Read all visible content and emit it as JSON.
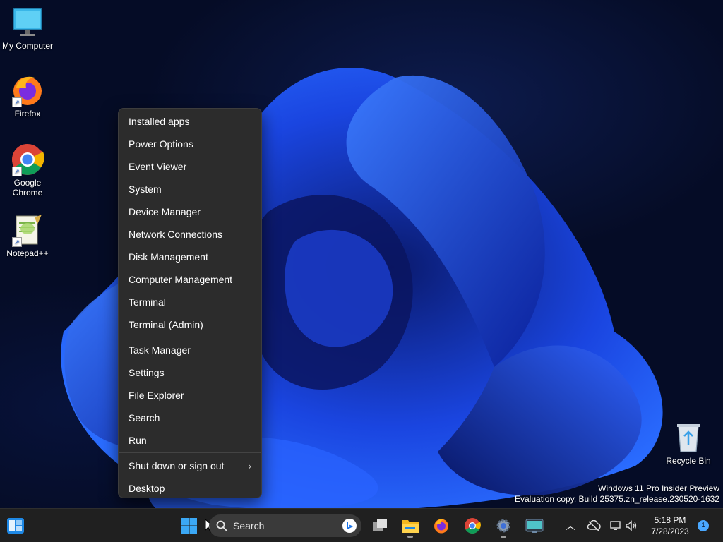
{
  "desktop": {
    "icons": [
      {
        "label": "My Computer",
        "icon": "monitor-icon"
      },
      {
        "label": "Firefox",
        "icon": "firefox-icon"
      },
      {
        "label": "Google Chrome",
        "icon": "chrome-icon"
      },
      {
        "label": "Notepad++",
        "icon": "notepadpp-icon"
      },
      {
        "label": "Recycle Bin",
        "icon": "recycle-bin-icon"
      }
    ],
    "watermark": {
      "line1": "Windows 11 Pro Insider Preview",
      "line2": "Evaluation copy. Build 25375.zn_release.230520-1632"
    }
  },
  "context_menu": {
    "items": [
      {
        "label": "Installed apps"
      },
      {
        "label": "Power Options"
      },
      {
        "label": "Event Viewer"
      },
      {
        "label": "System"
      },
      {
        "label": "Device Manager"
      },
      {
        "label": "Network Connections"
      },
      {
        "label": "Disk Management"
      },
      {
        "label": "Computer Management"
      },
      {
        "label": "Terminal"
      },
      {
        "label": "Terminal (Admin)"
      },
      {
        "label": "Task Manager"
      },
      {
        "label": "Settings"
      },
      {
        "label": "File Explorer"
      },
      {
        "label": "Search"
      },
      {
        "label": "Run"
      },
      {
        "label": "Shut down or sign out",
        "submenu_glyph": "›"
      },
      {
        "label": "Desktop"
      }
    ]
  },
  "taskbar": {
    "search_placeholder": "Search",
    "apps": [
      "widgets-icon",
      "start-icon",
      "task-view-icon",
      "file-explorer-icon",
      "firefox-icon",
      "chrome-icon",
      "settings-icon",
      "remote-desktop-icon"
    ],
    "tray": {
      "time": "5:18 PM",
      "date": "7/28/2023",
      "notification_count": "1"
    }
  },
  "colors": {
    "menu_bg": "#2c2c2c",
    "taskbar_bg": "#202020",
    "accent": "#4aa8ff"
  }
}
